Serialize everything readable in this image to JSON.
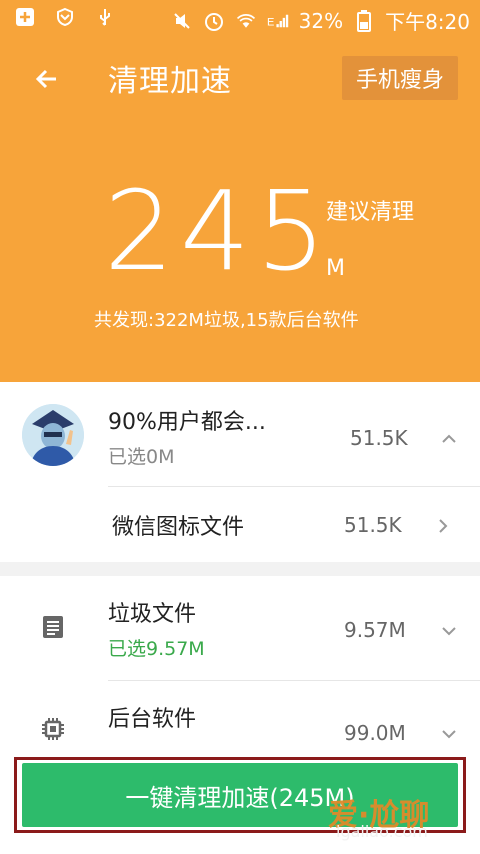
{
  "status_bar": {
    "battery_percent": "32%",
    "time": "下午8:20"
  },
  "header": {
    "title": "清理加速",
    "right_button": "手机瘦身",
    "big_number": "245",
    "suggest_label": "建议清理",
    "unit": "M",
    "found_text": "共发现:322M垃圾,15款后台软件",
    "background_color": "#f7a43a"
  },
  "list": {
    "app_item": {
      "title": "90%用户都会...",
      "subtitle": "已选0M",
      "size": "51.5K"
    },
    "sub_item": {
      "title": "微信图标文件",
      "size": "51.5K"
    },
    "junk_item": {
      "title": "垃圾文件",
      "subtitle": "已选9.57M",
      "size": "9.57M"
    },
    "background_item": {
      "title": "后台软件",
      "size": "99.0M"
    }
  },
  "bottom": {
    "button_label": "一键清理加速(245M)",
    "button_color": "#2dbb6b"
  },
  "watermark": {
    "text": "爱·尬聊",
    "url": "igaliao.com"
  }
}
